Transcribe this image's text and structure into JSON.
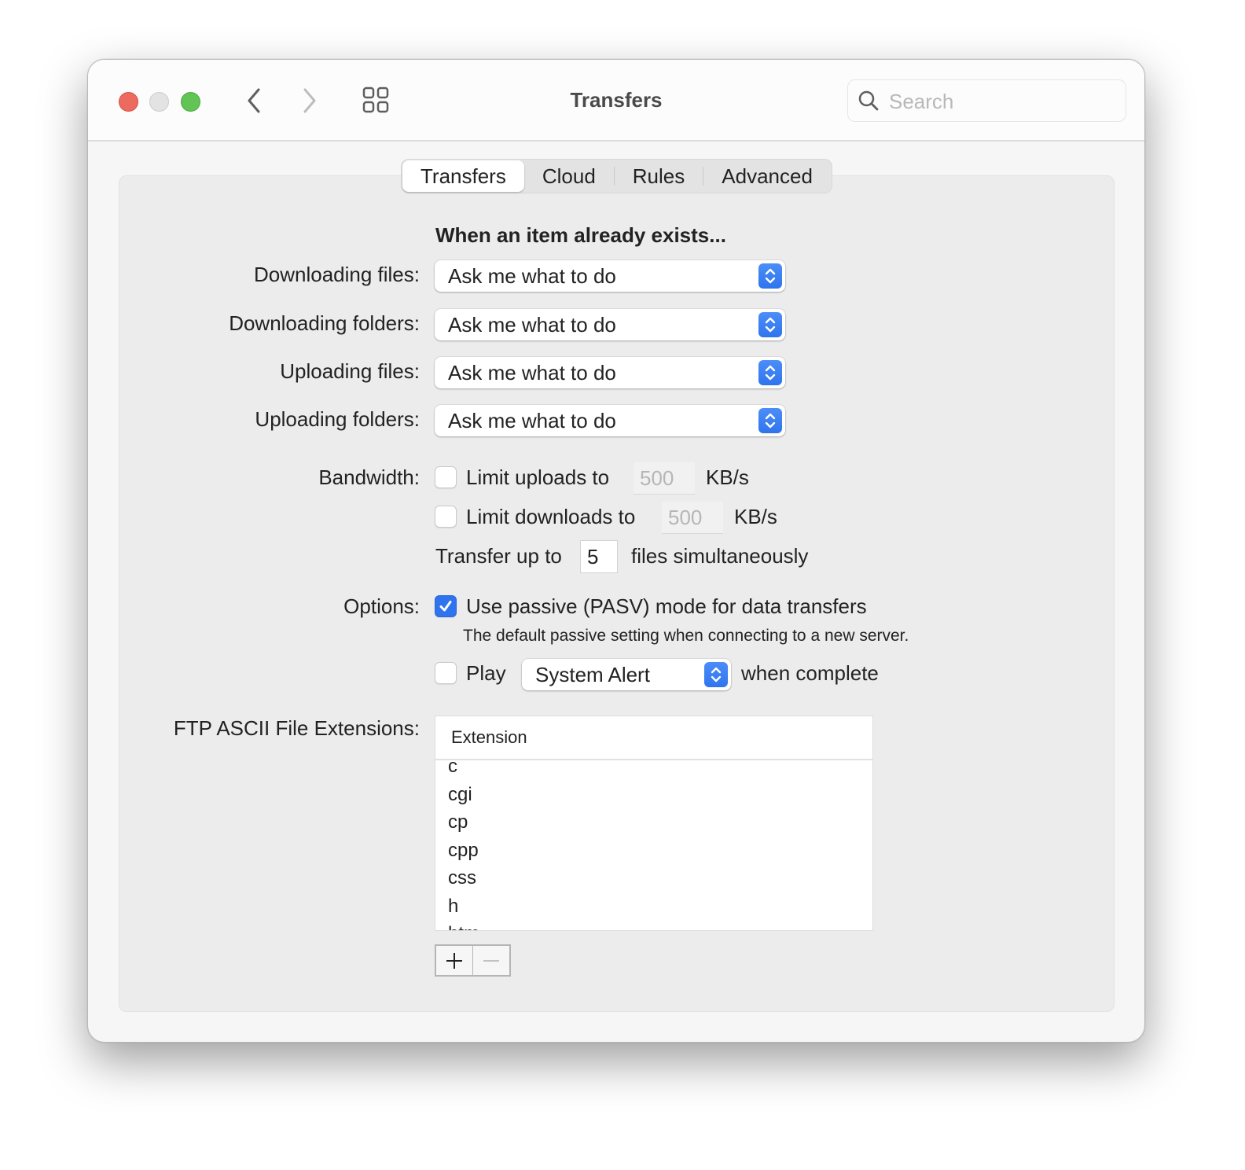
{
  "window": {
    "title": "Transfers",
    "search_placeholder": "Search"
  },
  "tabs": [
    {
      "label": "Transfers",
      "active": true
    },
    {
      "label": "Cloud",
      "active": false
    },
    {
      "label": "Rules",
      "active": false
    },
    {
      "label": "Advanced",
      "active": false
    }
  ],
  "exists_section": {
    "heading": "When an item already exists...",
    "rows": [
      {
        "label": "Downloading files:",
        "value": "Ask me what to do"
      },
      {
        "label": "Downloading folders:",
        "value": "Ask me what to do"
      },
      {
        "label": "Uploading files:",
        "value": "Ask me what to do"
      },
      {
        "label": "Uploading folders:",
        "value": "Ask me what to do"
      }
    ]
  },
  "bandwidth": {
    "label": "Bandwidth:",
    "limit_uploads": {
      "label": "Limit uploads to",
      "checked": false,
      "value": "500",
      "unit": "KB/s"
    },
    "limit_downloads": {
      "label": "Limit downloads to",
      "checked": false,
      "value": "500",
      "unit": "KB/s"
    },
    "transfer_prefix": "Transfer up to",
    "transfer_value": "5",
    "transfer_suffix": "files simultaneously"
  },
  "options": {
    "label": "Options:",
    "passive": {
      "label": "Use passive (PASV) mode for data transfers",
      "checked": true
    },
    "passive_note": "The default passive setting when connecting to a new server.",
    "play": {
      "label": "Play",
      "checked": false,
      "sound": "System Alert",
      "suffix": "when complete"
    }
  },
  "ascii": {
    "label": "FTP ASCII File Extensions:",
    "column_header": "Extension",
    "rows": [
      "c",
      "cgi",
      "cp",
      "cpp",
      "css",
      "h",
      "htm"
    ],
    "add_label": "+",
    "remove_label": "−"
  },
  "colors": {
    "accent": "#2f74ee",
    "close": "#ec6a5e",
    "minimize": "#e3e3e3",
    "maximize": "#61c454"
  }
}
